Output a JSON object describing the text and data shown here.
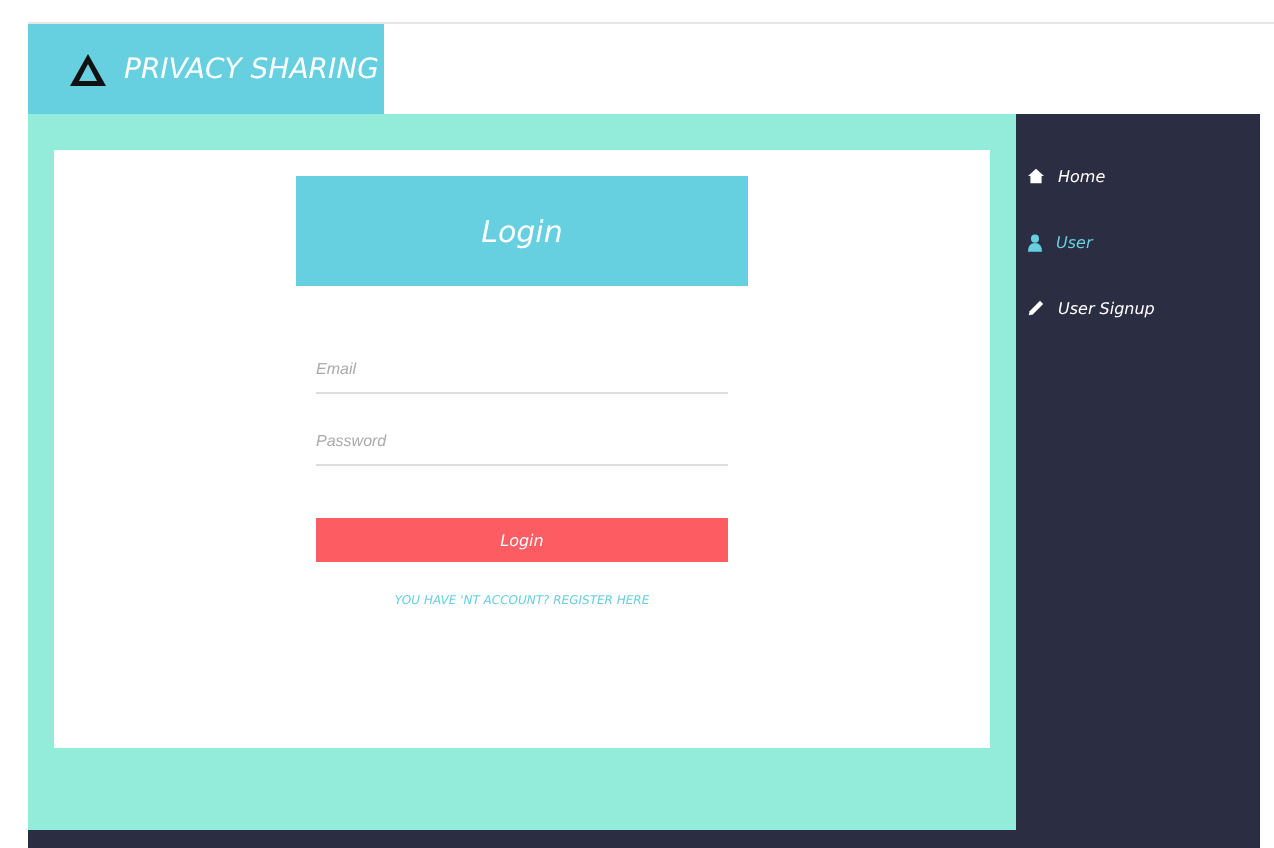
{
  "brand": {
    "name": "PRIVACY SHARING"
  },
  "login": {
    "title": "Login",
    "email": {
      "placeholder": "Email"
    },
    "password": {
      "placeholder": "Password"
    },
    "button": "Login",
    "register_link": "YOU HAVE 'NT ACCOUNT? REGISTER HERE"
  },
  "sidebar": {
    "items": [
      {
        "label": "Home",
        "kind": "home",
        "selected": false
      },
      {
        "label": "User",
        "kind": "user",
        "selected": true
      },
      {
        "label": "User Signup",
        "kind": "pencil",
        "selected": false
      }
    ]
  }
}
